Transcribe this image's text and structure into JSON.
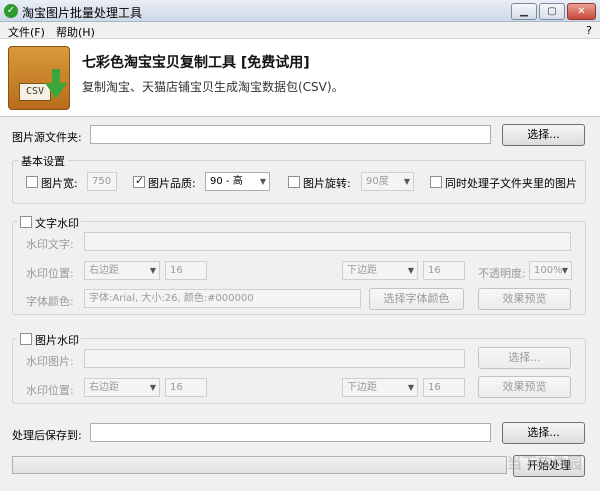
{
  "window": {
    "title": "淘宝图片批量处理工具",
    "help_mark": "?"
  },
  "menu": {
    "file": "文件(F)",
    "help": "帮助(H)"
  },
  "banner": {
    "title": "七彩色淘宝宝贝复制工具 [免费试用]",
    "subtitle": "复制淘宝、天猫店铺宝贝生成淘宝数据包(CSV)。",
    "logo_text": "CSV"
  },
  "source": {
    "label": "图片源文件夹:",
    "value": "",
    "button": "选择..."
  },
  "basic": {
    "title": "基本设置",
    "width": {
      "label": "图片宽:",
      "value": "750",
      "checked": false
    },
    "quality": {
      "label": "图片品质:",
      "value": "90 - 高",
      "checked": true
    },
    "rotate": {
      "label": "图片旋转:",
      "value": "90度",
      "checked": false
    },
    "subfolders": {
      "label": "同时处理子文件夹里的图片",
      "checked": false
    }
  },
  "text_wm": {
    "title": "文字水印",
    "text_label": "水印文字:",
    "text_value": "",
    "pos_label": "水印位置:",
    "h_pos": "右边距",
    "h_val": "16",
    "v_pos": "下边距",
    "v_val": "16",
    "opacity_label": "不透明度:",
    "opacity": "100%",
    "font_label": "字体颜色:",
    "font_value": "字体:Arial, 大小:26, 颜色:#000000",
    "font_button": "选择字体颜色",
    "preview_button": "效果预览"
  },
  "image_wm": {
    "title": "图片水印",
    "img_label": "水印图片:",
    "img_value": "",
    "browse_button": "选择...",
    "pos_label": "水印位置:",
    "h_pos": "右边距",
    "h_val": "16",
    "v_pos": "下边距",
    "v_val": "16",
    "preview_button": "效果预览"
  },
  "output": {
    "label": "处理后保存到:",
    "value": "",
    "button": "选择..."
  },
  "start_button": "开始处理",
  "watermark": "当下软件园",
  "colors": {
    "titlebar": "#cfd9e8",
    "logo": "#c57f28",
    "arrow": "#3aa53a",
    "close": "#c9493a"
  }
}
